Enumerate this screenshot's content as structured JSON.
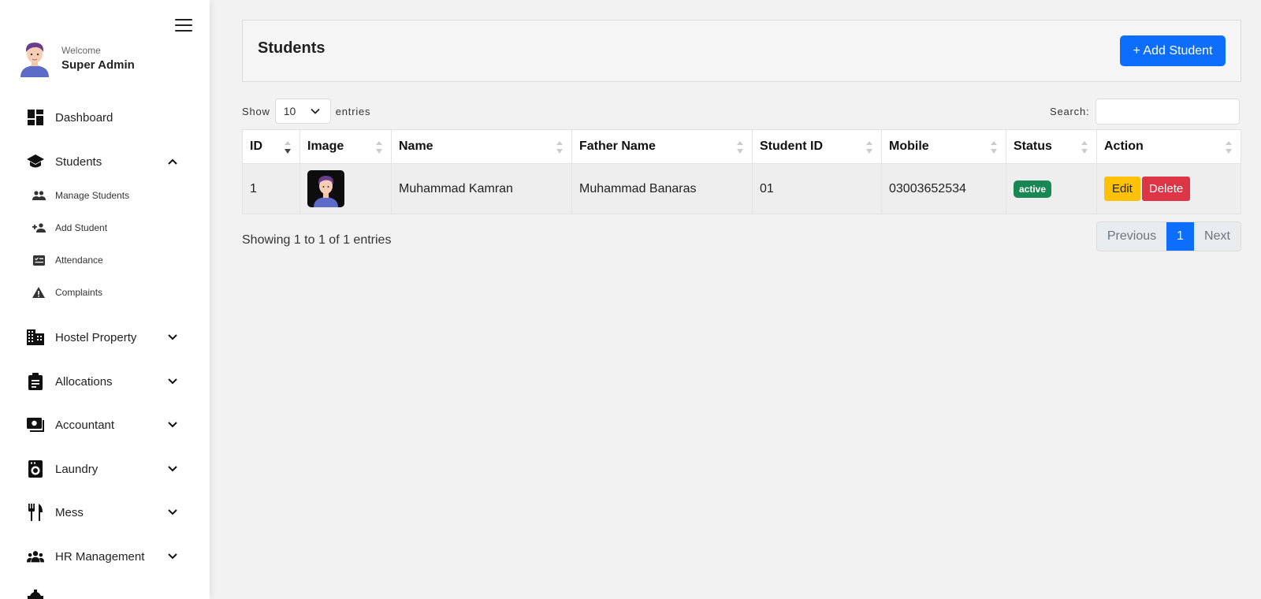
{
  "sidebar": {
    "welcome": "Welcome",
    "user_name": "Super Admin",
    "items": [
      {
        "label": "Dashboard",
        "icon": "dashboard-icon"
      },
      {
        "label": "Students",
        "icon": "graduation-cap-icon",
        "expanded": true
      },
      {
        "label": "Hostel Property",
        "icon": "building-icon"
      },
      {
        "label": "Allocations",
        "icon": "clipboard-icon"
      },
      {
        "label": "Accountant",
        "icon": "money-icon"
      },
      {
        "label": "Laundry",
        "icon": "washing-machine-icon"
      },
      {
        "label": "Mess",
        "icon": "utensils-icon"
      },
      {
        "label": "HR Management",
        "icon": "users-icon"
      }
    ],
    "students_submenu": [
      {
        "label": "Manage Students",
        "icon": "people-icon"
      },
      {
        "label": "Add Student",
        "icon": "person-add-icon"
      },
      {
        "label": "Attendance",
        "icon": "checklist-icon"
      },
      {
        "label": "Complaints",
        "icon": "warning-icon"
      }
    ]
  },
  "header": {
    "title": "Students",
    "add_button": "+ Add Student"
  },
  "controls": {
    "show_label": "Show",
    "entries_value": "10",
    "entries_label": "entries",
    "search_label": "Search:",
    "search_value": ""
  },
  "table": {
    "columns": [
      "ID",
      "Image",
      "Name",
      "Father Name",
      "Student ID",
      "Mobile",
      "Status",
      "Action"
    ],
    "rows": [
      {
        "id": "1",
        "name": "Muhammad Kamran",
        "father_name": "Muhammad Banaras",
        "student_id": "01",
        "mobile": "03003652534",
        "status": "active",
        "edit_label": "Edit",
        "delete_label": "Delete"
      }
    ]
  },
  "footer": {
    "info": "Showing 1 to 1 of 1 entries",
    "prev_label": "Previous",
    "page": "1",
    "next_label": "Next"
  },
  "colors": {
    "primary": "#0d6efd",
    "success": "#198754",
    "warning": "#ffc107",
    "danger": "#dc3545"
  }
}
